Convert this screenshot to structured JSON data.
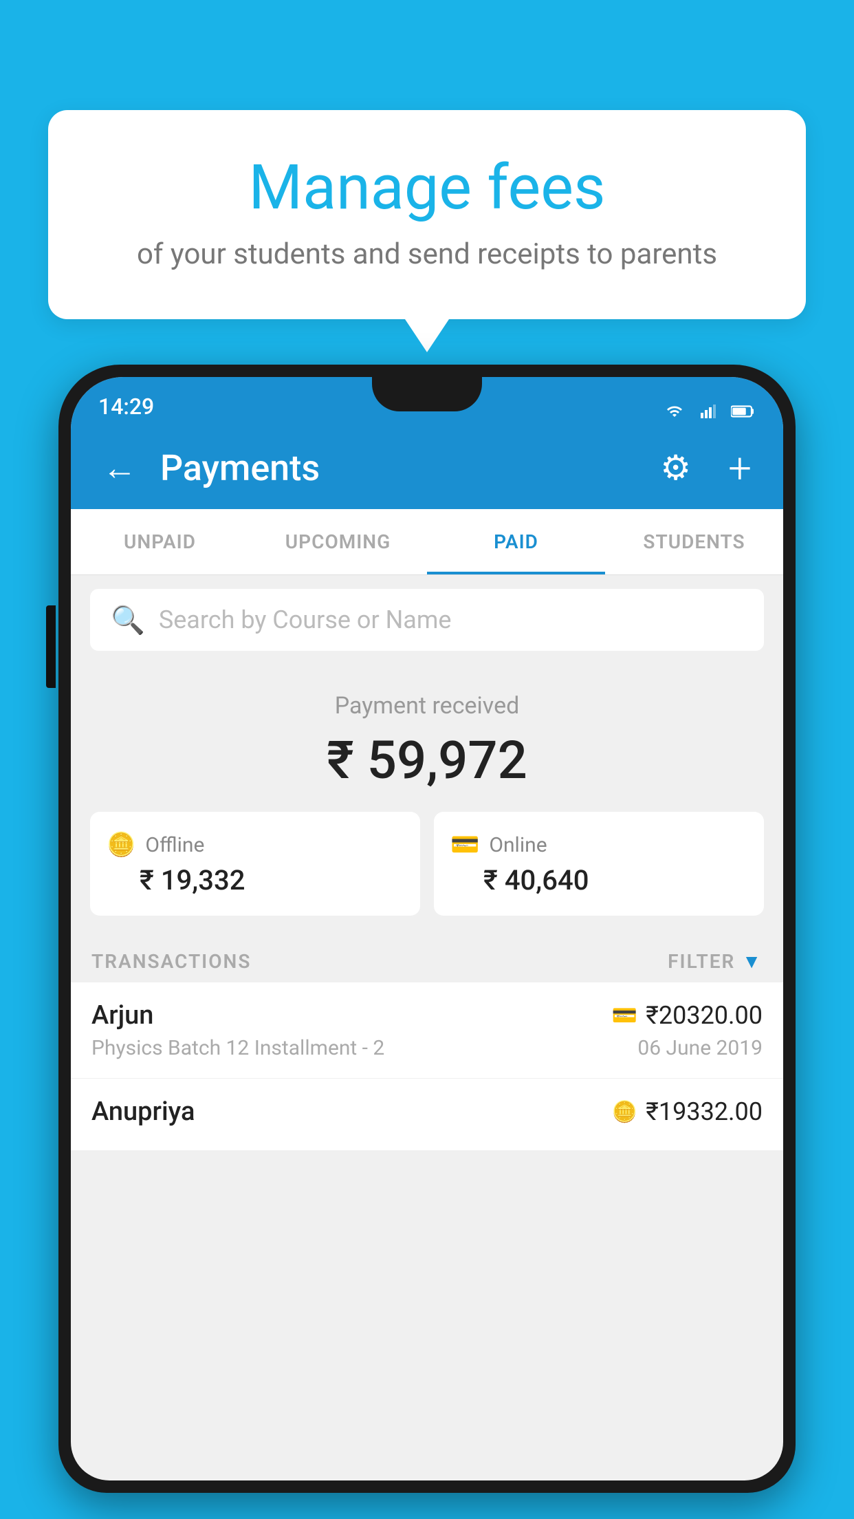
{
  "background_color": "#1ab3e8",
  "speech_bubble": {
    "title": "Manage fees",
    "subtitle": "of your students and send receipts to parents"
  },
  "status_bar": {
    "time": "14:29"
  },
  "app_bar": {
    "title": "Payments",
    "back_label": "←",
    "gear_label": "⚙",
    "plus_label": "+"
  },
  "tabs": [
    {
      "label": "UNPAID",
      "active": false
    },
    {
      "label": "UPCOMING",
      "active": false
    },
    {
      "label": "PAID",
      "active": true
    },
    {
      "label": "STUDENTS",
      "active": false
    }
  ],
  "search": {
    "placeholder": "Search by Course or Name"
  },
  "payment": {
    "label": "Payment received",
    "amount": "₹ 59,972",
    "offline": {
      "label": "Offline",
      "amount": "₹ 19,332"
    },
    "online": {
      "label": "Online",
      "amount": "₹ 40,640"
    }
  },
  "transactions": {
    "header": "TRANSACTIONS",
    "filter": "FILTER",
    "rows": [
      {
        "name": "Arjun",
        "amount": "₹20320.00",
        "course": "Physics Batch 12 Installment - 2",
        "date": "06 June 2019",
        "pay_type": "card"
      },
      {
        "name": "Anupriya",
        "amount": "₹19332.00",
        "course": "",
        "date": "",
        "pay_type": "cash"
      }
    ]
  },
  "icons": {
    "search": "🔍",
    "back": "←",
    "gear": "⚙",
    "plus": "+",
    "filter": "▼",
    "card": "💳",
    "cash": "💵",
    "offline_card": "🪙",
    "online_card": "💳"
  }
}
